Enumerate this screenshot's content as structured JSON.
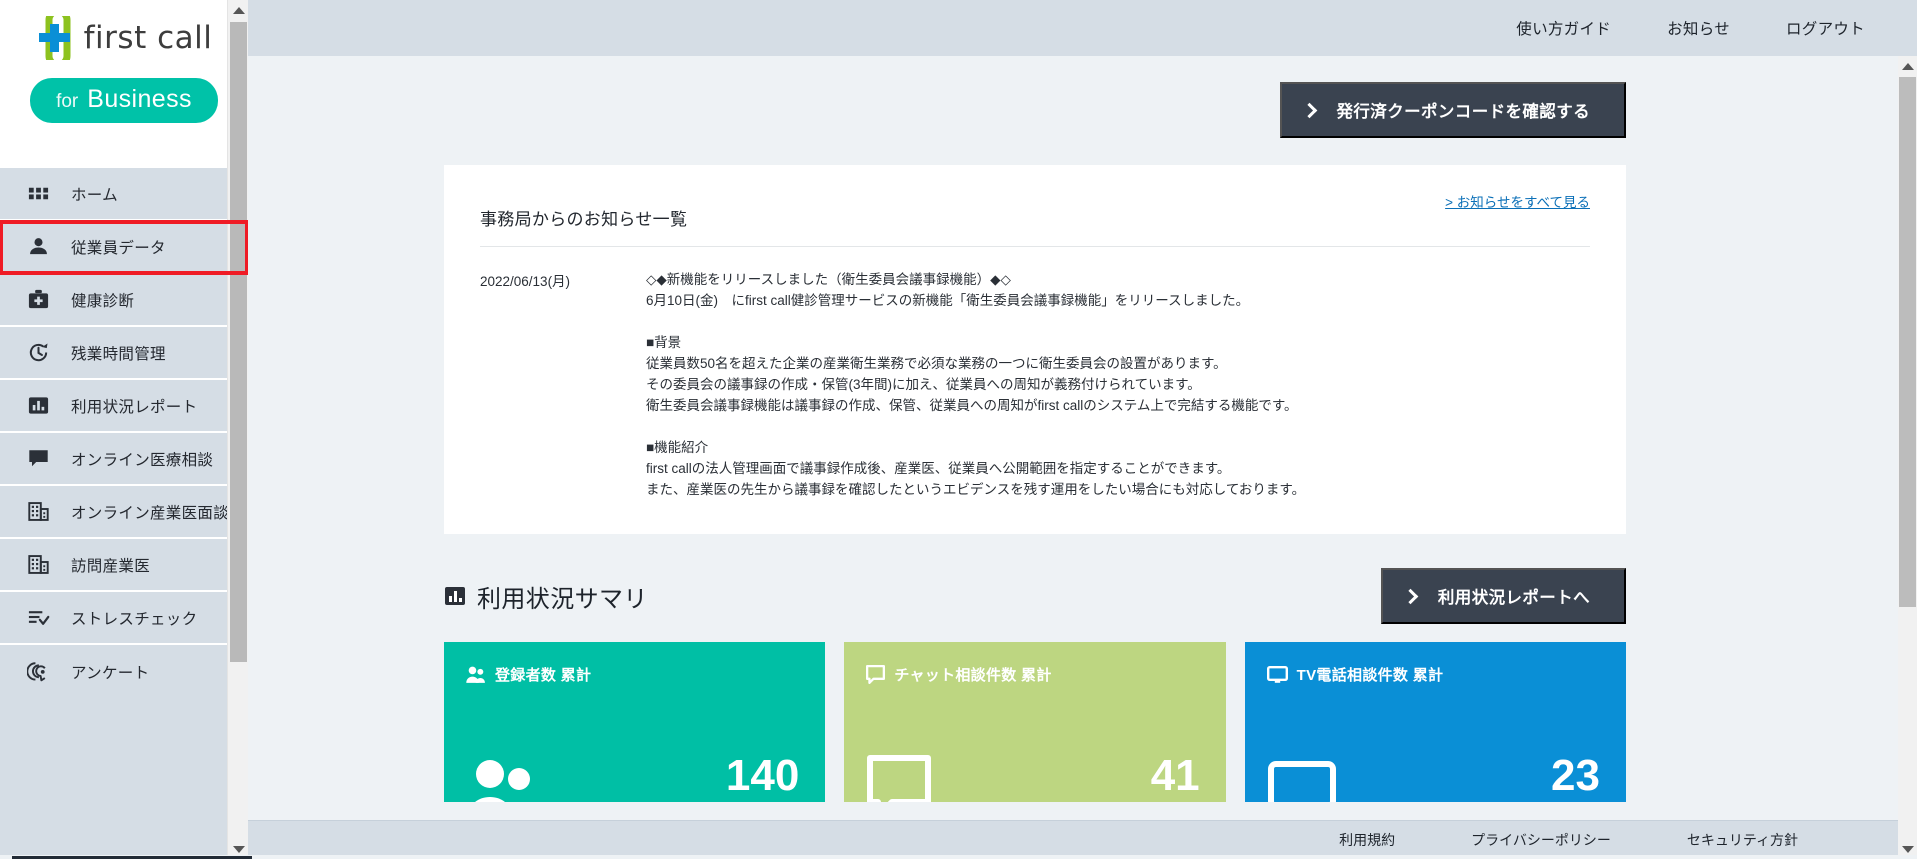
{
  "brand": {
    "logo_text": "first call",
    "badge_prefix": "for",
    "badge_main": "Business",
    "logo_icon": "cross-plus-icon",
    "accent_green": "#8dc21f",
    "accent_blue": "#0a8fd6",
    "teal": "#00c2a8"
  },
  "sidebar": {
    "items": [
      {
        "label": "ホーム",
        "icon": "grid-icon",
        "name": "home",
        "highlight": false
      },
      {
        "label": "従業員データ",
        "icon": "person-icon",
        "name": "employee-data",
        "highlight": true
      },
      {
        "label": "健康診断",
        "icon": "medical-kit-icon",
        "name": "health-checkup",
        "highlight": false
      },
      {
        "label": "残業時間管理",
        "icon": "clock-refresh-icon",
        "name": "overtime-management",
        "highlight": false
      },
      {
        "label": "利用状況レポート",
        "icon": "bar-chart-icon",
        "name": "usage-report",
        "highlight": false
      },
      {
        "label": "オンライン医療相談",
        "icon": "chat-bubble-icon",
        "name": "online-medical-consultation",
        "highlight": false
      },
      {
        "label": "オンライン産業医面談",
        "icon": "building-icon",
        "name": "online-occupational-physician-interview",
        "highlight": false
      },
      {
        "label": "訪問産業医",
        "icon": "building-icon",
        "name": "visiting-occupational-physician",
        "highlight": false
      },
      {
        "label": "ストレスチェック",
        "icon": "list-check-icon",
        "name": "stress-check",
        "highlight": false
      },
      {
        "label": "アンケート",
        "icon": "megaphone-icon",
        "name": "survey",
        "highlight": false
      }
    ]
  },
  "topbar": {
    "links": [
      {
        "label": "使い方ガイド",
        "name": "usage-guide"
      },
      {
        "label": "お知らせ",
        "name": "notifications"
      },
      {
        "label": "ログアウト",
        "name": "logout"
      }
    ]
  },
  "coupon_button": {
    "label": "発行済クーポンコードを確認する",
    "icon": "chevron-right-icon",
    "bg": "#3a4350"
  },
  "notice_panel": {
    "title": "事務局からのお知らせ一覧",
    "see_all_label": "> お知らせをすべて見る",
    "see_all_color": "#0a6fb7",
    "entry": {
      "date": "2022/06/13(月)",
      "lines": [
        "◇◆新機能をリリースしました（衛生委員会議事録機能）◆◇",
        "6月10日(金)　にfirst call健診管理サービスの新機能「衛生委員会議事録機能」をリリースしました。",
        "",
        "■背景",
        "従業員数50名を超えた企業の産業衛生業務で必須な業務の一つに衛生委員会の設置があります。",
        "その委員会の議事録の作成・保管(3年間)に加え、従業員への周知が義務付けられています。",
        "衛生委員会議事録機能は議事録の作成、保管、従業員への周知がfirst callのシステム上で完結する機能です。",
        "",
        "■機能紹介",
        "first callの法人管理画面で議事録作成後、産業医、従業員へ公開範囲を指定することができます。",
        "また、産業医の先生から議事録を確認したというエビデンスを残す運用をしたい場合にも対応しております。"
      ]
    }
  },
  "summary": {
    "title": "利用状況サマリ",
    "title_icon": "bar-chart-icon",
    "report_button": {
      "label": "利用状況レポートへ",
      "icon": "chevron-right-icon"
    },
    "cards": [
      {
        "label": "登録者数 累計",
        "value": "140",
        "color": "#00bfa5",
        "icon": "people-icon",
        "name": "registered-users-card"
      },
      {
        "label": "チャット相談件数 累計",
        "value": "41",
        "color": "#bdd681",
        "icon": "chat-bubble-icon",
        "name": "chat-consultations-card"
      },
      {
        "label": "TV電話相談件数 累計",
        "value": "23",
        "color": "#0a8fd6",
        "icon": "monitor-icon",
        "name": "video-consultations-card"
      }
    ]
  },
  "footer": {
    "links": [
      {
        "label": "利用規約",
        "name": "terms-of-service"
      },
      {
        "label": "プライバシーポリシー",
        "name": "privacy-policy"
      },
      {
        "label": "セキュリティ方針",
        "name": "security-policy"
      }
    ]
  }
}
